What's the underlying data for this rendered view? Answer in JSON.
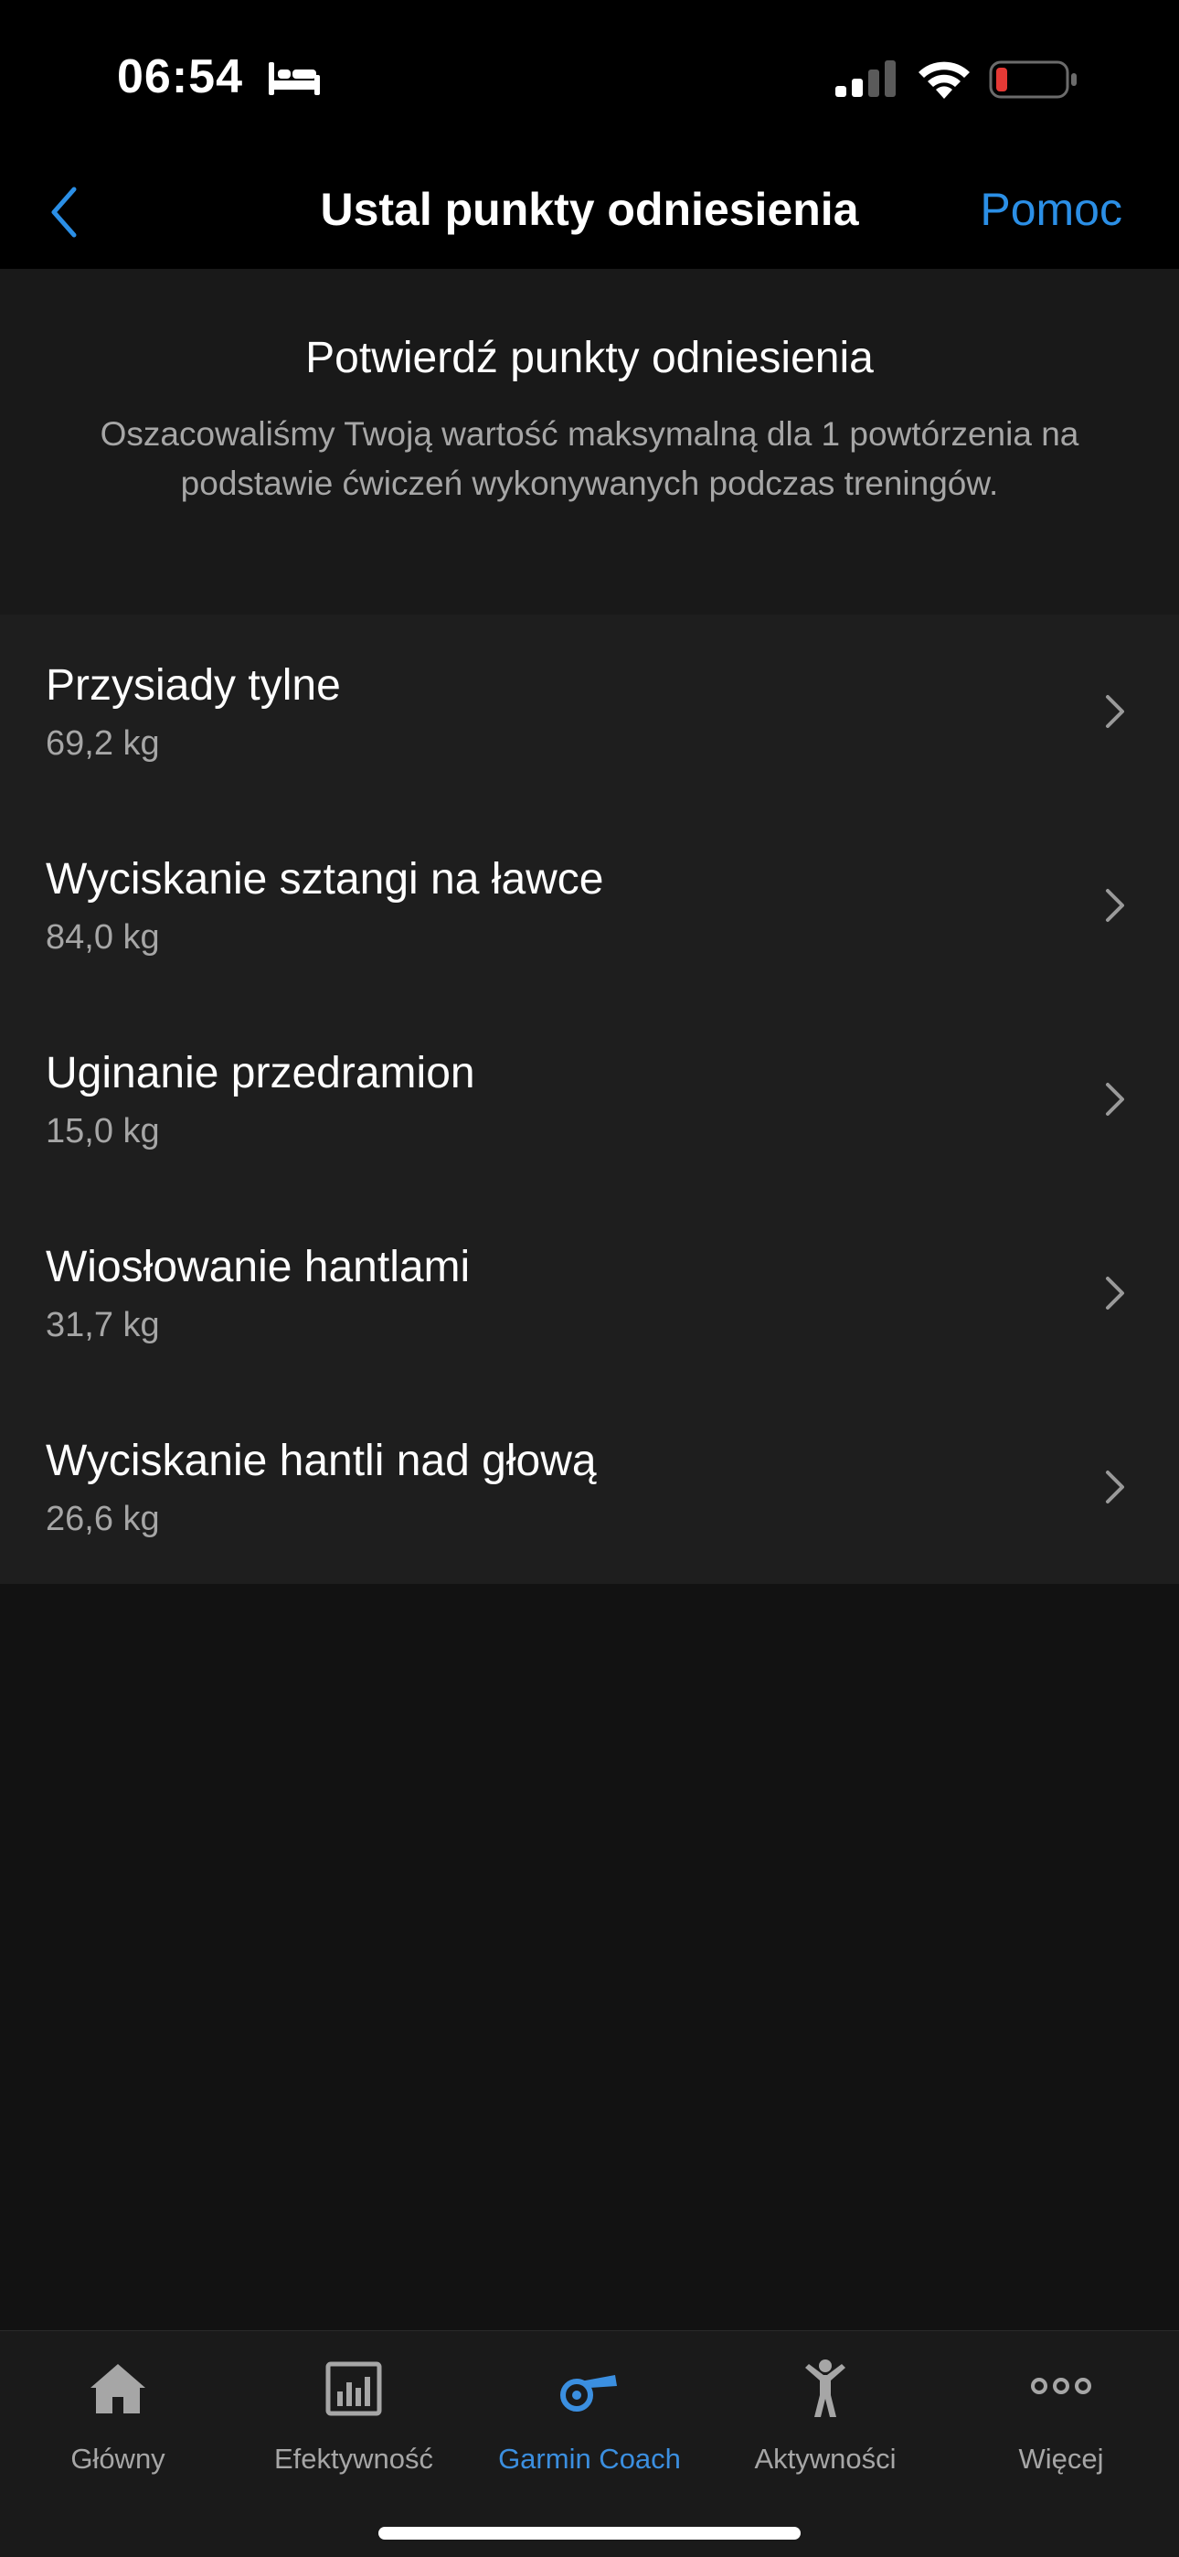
{
  "status_bar": {
    "time": "06:54"
  },
  "nav": {
    "title": "Ustal punkty odniesienia",
    "help_label": "Pomoc"
  },
  "intro": {
    "title": "Potwierdź punkty odniesienia",
    "description": "Oszacowaliśmy Twoją wartość maksymalną dla 1 powtórzenia na podstawie ćwiczeń wykonywanych podczas treningów."
  },
  "exercises": [
    {
      "name": "Przysiady tylne",
      "value": "69,2 kg"
    },
    {
      "name": "Wyciskanie sztangi na ławce",
      "value": "84,0 kg"
    },
    {
      "name": "Uginanie przedramion",
      "value": "15,0 kg"
    },
    {
      "name": "Wiosłowanie hantlami",
      "value": "31,7 kg"
    },
    {
      "name": "Wyciskanie hantli nad głową",
      "value": "26,6 kg"
    }
  ],
  "tabs": [
    {
      "label": "Główny",
      "icon": "home-icon",
      "active": false
    },
    {
      "label": "Efektywność",
      "icon": "chart-icon",
      "active": false
    },
    {
      "label": "Garmin Coach",
      "icon": "whistle-icon",
      "active": true
    },
    {
      "label": "Aktywności",
      "icon": "person-icon",
      "active": false
    },
    {
      "label": "Więcej",
      "icon": "more-icon",
      "active": false
    }
  ],
  "colors": {
    "accent": "#2b8fe6",
    "background": "#121212",
    "list_background": "#1e1e1e",
    "secondary_text": "#a6a6a6",
    "battery_low": "#e53935"
  }
}
